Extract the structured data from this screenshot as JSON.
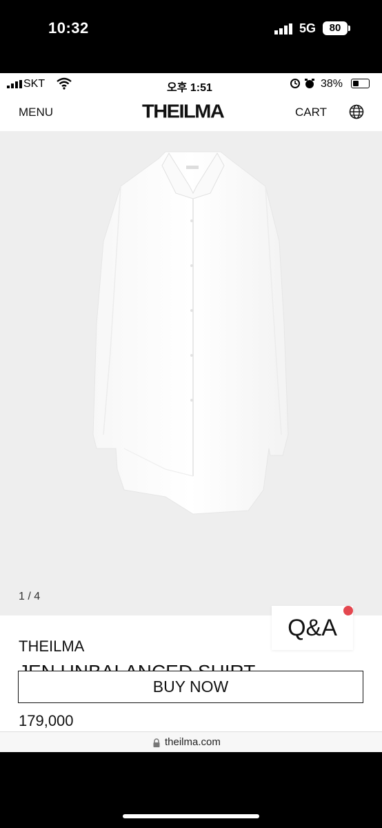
{
  "outer_status": {
    "time": "10:32",
    "network": "5G",
    "battery": "80"
  },
  "inner_status": {
    "carrier": "SKT",
    "time": "오후 1:51",
    "battery_pct": "38%"
  },
  "header": {
    "menu_label": "MENU",
    "logo": "THEILMA",
    "cart_label": "CART",
    "globe_icon": "globe-icon"
  },
  "gallery": {
    "pager": "1 / 4"
  },
  "product": {
    "brand": "THEILMA",
    "name": "JEN UNBALANCED SHIRT",
    "buy_label": "BUY NOW",
    "price": "179,000"
  },
  "qa": {
    "label": "Q&A",
    "dot_color": "#e4474f"
  },
  "browser": {
    "url": "theilma.com"
  }
}
